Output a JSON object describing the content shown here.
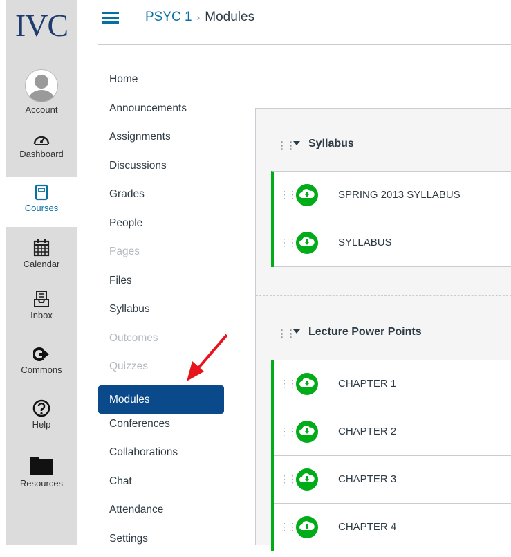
{
  "logo": "IVC",
  "global_nav": [
    {
      "label": "Account",
      "icon": "avatar"
    },
    {
      "label": "Dashboard",
      "icon": "dashboard-icon"
    },
    {
      "label": "Courses",
      "icon": "courses-icon"
    },
    {
      "label": "Calendar",
      "icon": "calendar-icon"
    },
    {
      "label": "Inbox",
      "icon": "inbox-icon"
    },
    {
      "label": "Commons",
      "icon": "commons-icon"
    },
    {
      "label": "Help",
      "icon": "help-icon"
    },
    {
      "label": "Resources",
      "icon": "folder-icon"
    }
  ],
  "breadcrumb": {
    "course": "PSYC 1",
    "separator": "›",
    "current": "Modules"
  },
  "course_nav": [
    {
      "label": "Home"
    },
    {
      "label": "Announcements"
    },
    {
      "label": "Assignments"
    },
    {
      "label": "Discussions"
    },
    {
      "label": "Grades"
    },
    {
      "label": "People"
    },
    {
      "label": "Pages"
    },
    {
      "label": "Files"
    },
    {
      "label": "Syllabus"
    },
    {
      "label": "Outcomes"
    },
    {
      "label": "Quizzes"
    },
    {
      "label": "Modules"
    },
    {
      "label": "Conferences"
    },
    {
      "label": "Collaborations"
    },
    {
      "label": "Chat"
    },
    {
      "label": "Attendance"
    },
    {
      "label": "Settings"
    }
  ],
  "modules": [
    {
      "title": "Syllabus",
      "items": [
        "SPRING 2013 SYLLABUS",
        "SYLLABUS"
      ]
    },
    {
      "title": "Lecture Power Points",
      "items": [
        "CHAPTER 1",
        "CHAPTER 2",
        "CHAPTER 3",
        "CHAPTER 4"
      ]
    }
  ],
  "colors": {
    "accent": "#0770a3",
    "active_nav": "#0b4a8a",
    "published": "#00ac18",
    "annotation_arrow": "#e8141b"
  }
}
